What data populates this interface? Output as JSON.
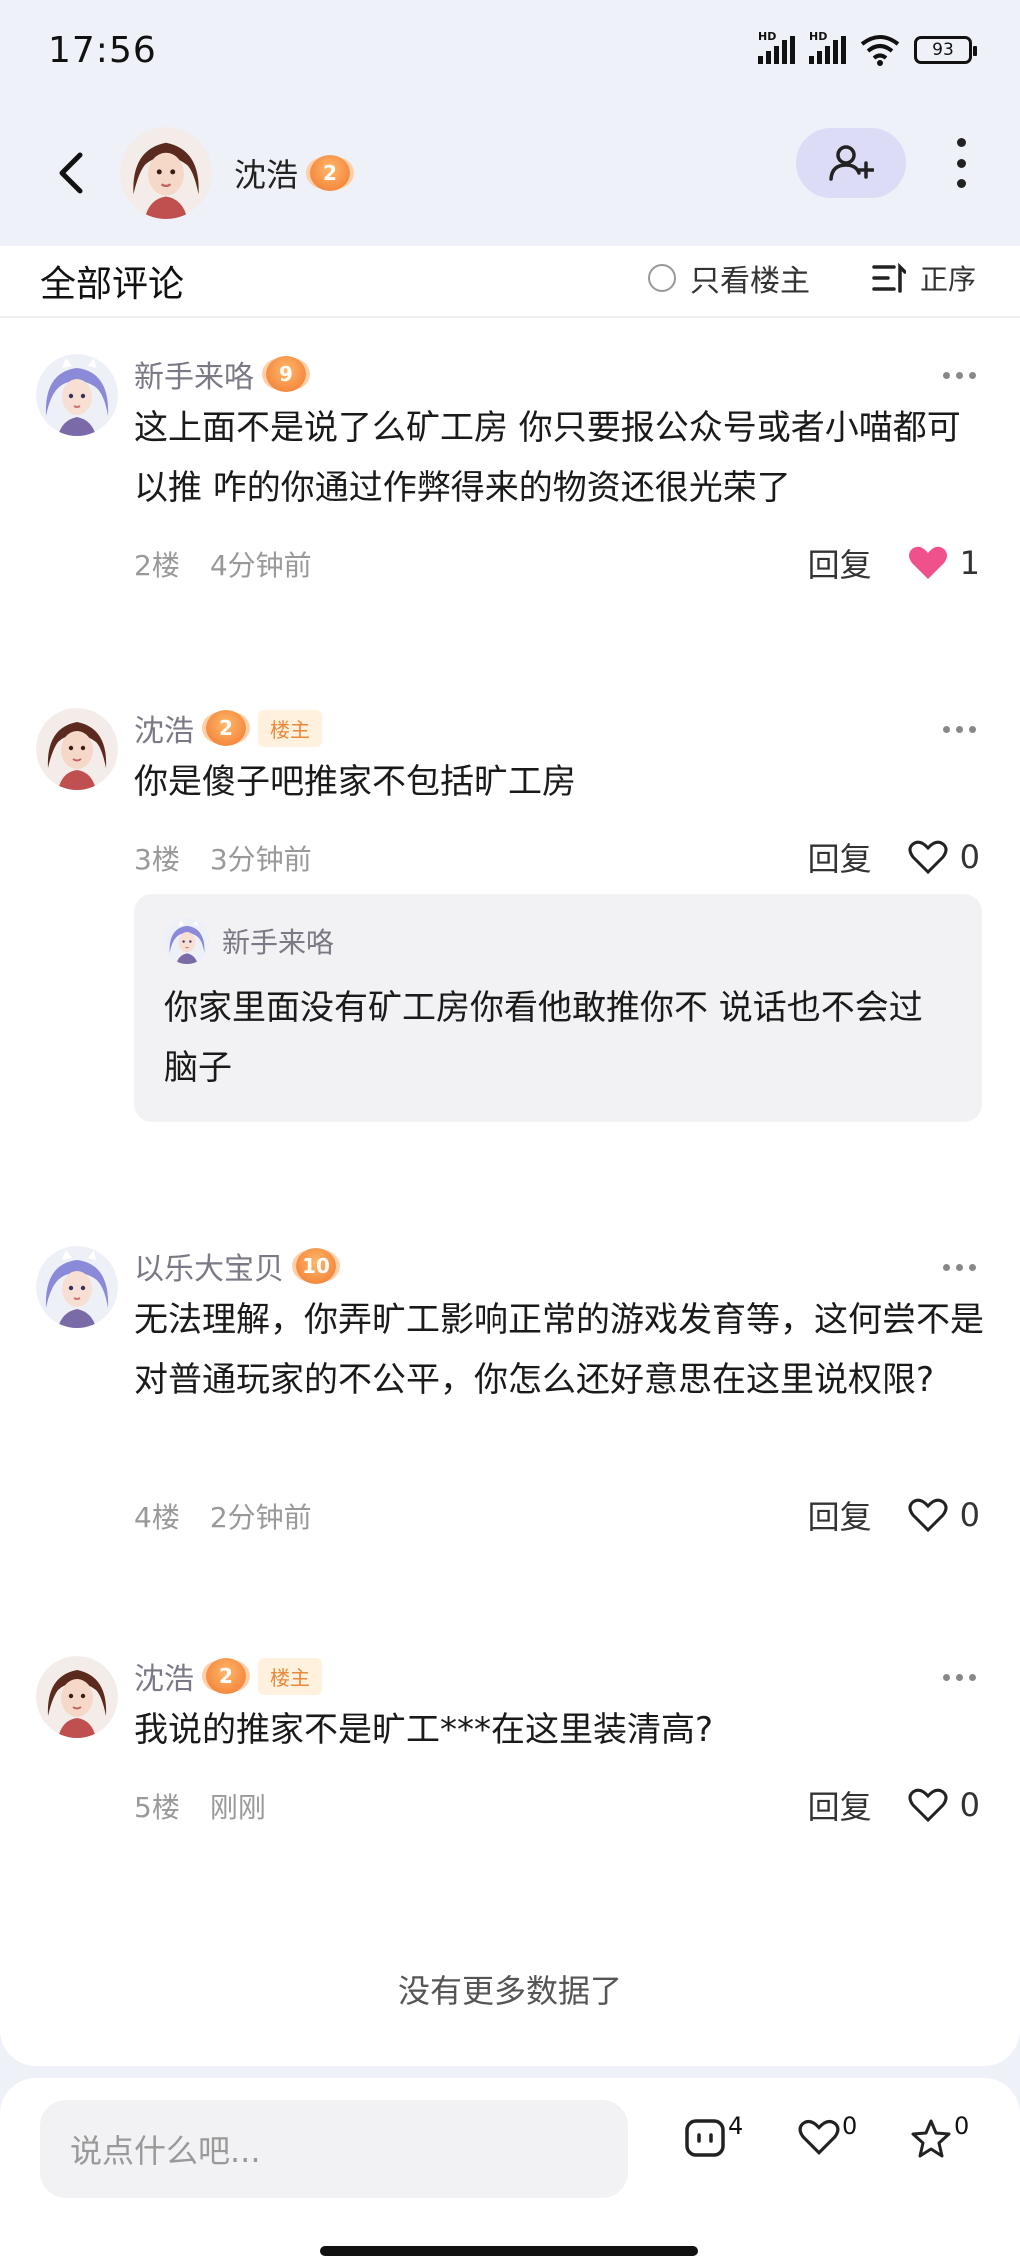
{
  "status": {
    "time": "17:56",
    "battery": "93",
    "hd": "HD"
  },
  "header": {
    "user_name": "沈浩",
    "user_level": "2"
  },
  "comments_header": {
    "title": "全部评论",
    "only_owner": "只看楼主",
    "sort": "正序"
  },
  "comments": [
    {
      "name": "新手来咯",
      "level": "9",
      "text": "这上面不是说了么矿工房 你只要报公众号或者小喵都可以推 咋的你通过作弊得来的物资还很光荣了",
      "floor": "2楼",
      "time": "4分钟前",
      "reply": "回复",
      "likes": "1",
      "liked": true
    },
    {
      "name": "沈浩",
      "level": "2",
      "owner_tag": "楼主",
      "text": "你是傻子吧推家不包括旷工房",
      "floor": "3楼",
      "time": "3分钟前",
      "reply": "回复",
      "likes": "0",
      "sub_reply": {
        "name": "新手来咯",
        "text": "你家里面没有矿工房你看他敢推你不 说话也不会过脑子"
      }
    },
    {
      "name": "以乐大宝贝",
      "level": "10",
      "text": "无法理解，你弄旷工影响正常的游戏发育等，这何尝不是对普通玩家的不公平，你怎么还好意思在这里说权限?",
      "floor": "4楼",
      "time": "2分钟前",
      "reply": "回复",
      "likes": "0"
    },
    {
      "name": "沈浩",
      "level": "2",
      "owner_tag": "楼主",
      "text": "我说的推家不是旷工***在这里装清高?",
      "floor": "5楼",
      "time": "刚刚",
      "reply": "回复",
      "likes": "0"
    }
  ],
  "footer_note": "没有更多数据了",
  "bottom_bar": {
    "placeholder": "说点什么吧...",
    "comment_count": "4",
    "like_count": "0",
    "fav_count": "0"
  },
  "colors": {
    "accent": "#dcdcf7",
    "like_pink": "#f0508c",
    "badge_orange": "#f0772e",
    "owner_tag_bg": "#fff1de"
  }
}
